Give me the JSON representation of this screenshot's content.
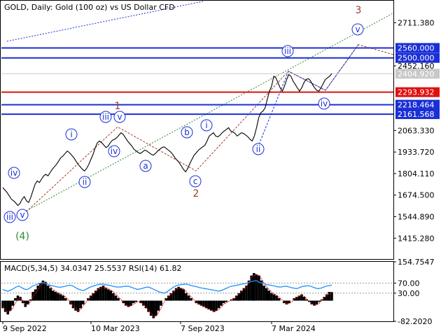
{
  "window": {
    "title": "GOLD, Daily:  Gold (100 oz) vs US Dollar CFD"
  },
  "colors": {
    "price_line": "#000000",
    "level_blue": "#1a2fd6",
    "level_red": "#e01010",
    "current_price_box": "#c8c8c8",
    "wave_blue": "#1a2fd6",
    "wave_red": "#a13c2c",
    "wave_green": "#2e8b2e",
    "macd_hist": "#000000",
    "rsi_line": "#1e90ff"
  },
  "chart_data": [
    {
      "type": "line",
      "title": "GOLD, Daily:  Gold (100 oz) vs US Dollar CFD",
      "xlabel": "",
      "ylabel": "",
      "ylim": [
        1290,
        2840
      ],
      "x_ticks": [
        "9 Sep 2022",
        "10 Mar 2023",
        "7 Sep 2023",
        "7 Mar 2024"
      ],
      "y_ticks": [
        "2711.380",
        "2452.160",
        "2063.330",
        "1933.720",
        "1804.110",
        "1674.500",
        "1544.890",
        "1415.280"
      ],
      "levels": [
        {
          "value": 2560.0,
          "label": "2560.000",
          "color": "blue"
        },
        {
          "value": 2500.0,
          "label": "2500.000",
          "color": "blue"
        },
        {
          "value": 2293.932,
          "label": "2293.932",
          "color": "red"
        },
        {
          "value": 2218.464,
          "label": "2218.464",
          "color": "blue"
        },
        {
          "value": 2161.568,
          "label": "2161.568",
          "color": "blue"
        }
      ],
      "current_price": {
        "value": 2404.92,
        "label": "2404.920"
      },
      "series": [
        {
          "values": [
            1720,
            1705,
            1690,
            1670,
            1650,
            1640,
            1628,
            1612,
            1625,
            1650,
            1665,
            1640,
            1630,
            1660,
            1700,
            1740,
            1760,
            1750,
            1770,
            1790,
            1800,
            1790,
            1810,
            1830,
            1845,
            1860,
            1880,
            1900,
            1910,
            1925,
            1940,
            1930,
            1915,
            1900,
            1880,
            1860,
            1845,
            1830,
            1820,
            1835,
            1860,
            1890,
            1920,
            1960,
            1990,
            2000,
            1990,
            1975,
            1960,
            1970,
            1990,
            2005,
            2010,
            2020,
            2035,
            2050,
            2040,
            2020,
            2000,
            1985,
            1970,
            1950,
            1940,
            1930,
            1925,
            1935,
            1945,
            1940,
            1930,
            1920,
            1915,
            1925,
            1940,
            1950,
            1960,
            1965,
            1955,
            1945,
            1935,
            1920,
            1900,
            1885,
            1870,
            1850,
            1830,
            1815,
            1835,
            1865,
            1890,
            1915,
            1930,
            1945,
            1955,
            1965,
            1975,
            2000,
            2030,
            2040,
            2050,
            2030,
            2025,
            2035,
            2050,
            2060,
            2070,
            2080,
            2060,
            2055,
            2045,
            2030,
            2040,
            2050,
            2045,
            2035,
            2025,
            2010,
            2000,
            2030,
            2080,
            2140,
            2170,
            2180,
            2200,
            2250,
            2300,
            2330,
            2390,
            2380,
            2350,
            2320,
            2300,
            2330,
            2370,
            2400,
            2390,
            2360,
            2340,
            2320,
            2300,
            2320,
            2350,
            2370,
            2375,
            2365,
            2340,
            2320,
            2305,
            2300,
            2320,
            2345,
            2370,
            2380,
            2390,
            2404.92
          ]
        }
      ],
      "wave_labels_blue": [
        "iii",
        "v",
        "iv",
        "i",
        "ii",
        "iii",
        "v",
        "iv",
        "a",
        "b",
        "c",
        "i",
        "ii",
        "iii",
        "iv",
        "v"
      ],
      "wave_labels_red": [
        "1",
        "2",
        "3"
      ],
      "wave_labels_green": [
        "(4)"
      ]
    },
    {
      "type": "bar",
      "title": "MACD(5,34,5) 34.0347 25.5537 RSI(14) 61.82",
      "ylim": [
        -82.202,
        154.7547
      ],
      "y_ticks": [
        "154.7547",
        "70.00",
        "30.00",
        "-82.2020"
      ],
      "hist_values": [
        -30,
        -45,
        -55,
        -40,
        -20,
        10,
        20,
        15,
        -10,
        -25,
        -15,
        5,
        35,
        45,
        60,
        70,
        80,
        75,
        60,
        50,
        40,
        35,
        30,
        25,
        20,
        10,
        0,
        -15,
        -30,
        -40,
        -45,
        -30,
        -15,
        0,
        10,
        20,
        30,
        40,
        50,
        55,
        60,
        50,
        45,
        40,
        30,
        20,
        10,
        0,
        -10,
        -20,
        -25,
        -20,
        -10,
        -5,
        0,
        -10,
        -20,
        -30,
        -45,
        -60,
        -70,
        -60,
        -40,
        -20,
        0,
        10,
        20,
        30,
        40,
        50,
        55,
        50,
        45,
        30,
        20,
        10,
        0,
        -10,
        -15,
        -20,
        -25,
        -30,
        -35,
        -40,
        -45,
        -40,
        -30,
        -20,
        -10,
        -5,
        0,
        5,
        10,
        20,
        30,
        40,
        50,
        60,
        80,
        100,
        110,
        105,
        100,
        80,
        60,
        50,
        40,
        30,
        25,
        20,
        10,
        0,
        -10,
        -15,
        -10,
        0,
        10,
        15,
        20,
        25,
        15,
        5,
        -5,
        -15,
        -20,
        -15,
        -5,
        5,
        15,
        25,
        35,
        34.03
      ],
      "signal_values": [
        -25,
        -35,
        -45,
        -42,
        -30,
        -10,
        5,
        12,
        0,
        -15,
        -15,
        -5,
        15,
        30,
        45,
        60,
        70,
        72,
        65,
        55,
        45,
        38,
        32,
        27,
        22,
        15,
        5,
        -8,
        -20,
        -32,
        -40,
        -35,
        -22,
        -8,
        5,
        15,
        25,
        35,
        45,
        50,
        55,
        52,
        48,
        42,
        35,
        25,
        15,
        5,
        -5,
        -15,
        -22,
        -22,
        -15,
        -8,
        -3,
        -6,
        -15,
        -25,
        -38,
        -50,
        -62,
        -62,
        -48,
        -30,
        -10,
        5,
        15,
        25,
        35,
        45,
        50,
        50,
        47,
        36,
        25,
        15,
        5,
        -5,
        -12,
        -18,
        -22,
        -28,
        -32,
        -37,
        -42,
        -42,
        -35,
        -25,
        -15,
        -8,
        -3,
        2,
        7,
        15,
        25,
        35,
        45,
        55,
        70,
        88,
        100,
        103,
        100,
        88,
        70,
        56,
        45,
        35,
        28,
        22,
        14,
        5,
        -5,
        -12,
        -12,
        -5,
        5,
        12,
        18,
        22,
        18,
        8,
        -2,
        -12,
        -18,
        -17,
        -10,
        0,
        10,
        20,
        28,
        25.55
      ],
      "rsi_values": [
        45,
        40,
        38,
        42,
        48,
        55,
        58,
        52,
        46,
        44,
        50,
        58,
        62,
        66,
        70,
        72,
        68,
        64,
        60,
        58,
        55,
        53,
        55,
        57,
        60,
        62,
        58,
        52,
        46,
        42,
        40,
        46,
        52,
        56,
        60,
        63,
        65,
        66,
        64,
        62,
        60,
        57,
        55,
        54,
        55,
        57,
        58,
        56,
        52,
        48,
        45,
        47,
        50,
        53,
        54,
        50,
        45,
        40,
        35,
        32,
        30,
        36,
        44,
        52,
        58,
        62,
        64,
        65,
        66,
        63,
        60,
        58,
        55,
        52,
        50,
        48,
        46,
        44,
        42,
        40,
        38,
        40,
        45,
        50,
        55,
        58,
        60,
        62,
        64,
        66,
        68,
        72,
        76,
        78,
        80,
        74,
        70,
        66,
        64,
        62,
        60,
        58,
        55,
        54,
        56,
        58,
        55,
        52,
        50,
        48,
        52,
        56,
        58,
        60,
        58,
        54,
        50,
        48,
        50,
        54,
        58,
        60,
        61.82
      ],
      "rsi_level_labels": [
        "70.00",
        "30.00"
      ]
    }
  ]
}
